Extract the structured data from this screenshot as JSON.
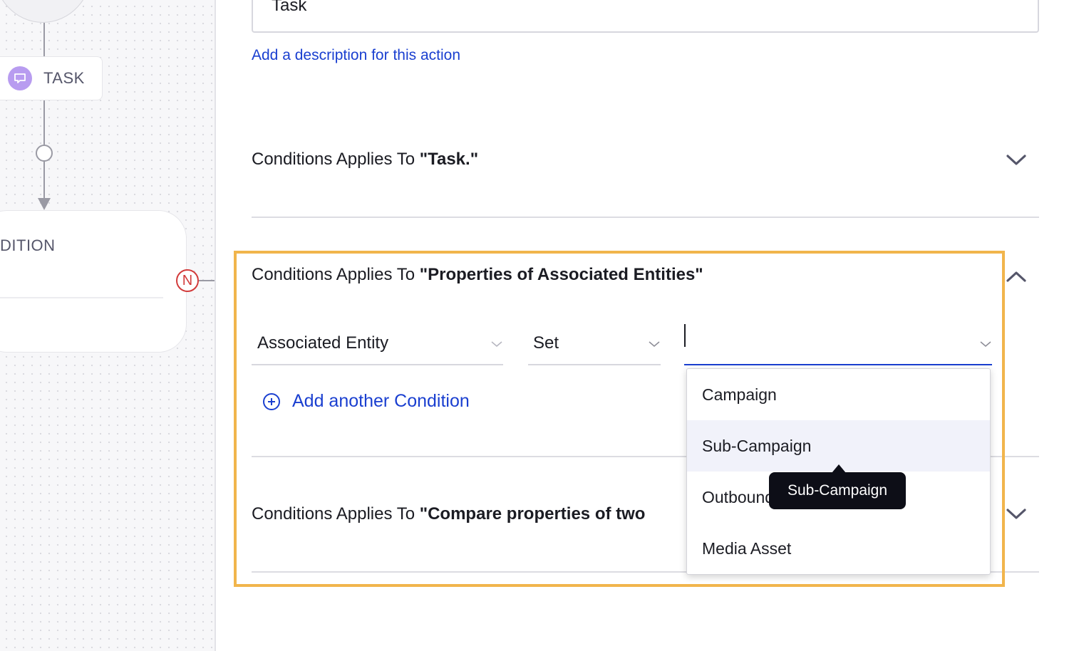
{
  "canvas": {
    "task_node": {
      "label": "TASK",
      "icon": "chat-bubble-icon",
      "icon_color": "#b89cf0"
    },
    "condition_node": {
      "label_partial": "DITION"
    },
    "no_branch_badge": "N"
  },
  "action": {
    "name_value": "Task",
    "add_description_link": "Add a description for this action"
  },
  "sections": [
    {
      "prefix": "Conditions Applies To ",
      "target": "\"Task.\"",
      "expanded": false,
      "toggle_icon": "chevron-down-icon"
    },
    {
      "prefix": "Conditions Applies To ",
      "target": "\"Properties of Associated Entities\"",
      "expanded": true,
      "toggle_icon": "chevron-up-icon",
      "condition_row": {
        "field_select": "Associated Entity",
        "operator_select": "Set",
        "value_select": ""
      },
      "add_condition_label": "Add another Condition"
    },
    {
      "prefix": "Conditions Applies To ",
      "target": "\"Compare properties of two",
      "expanded": false,
      "toggle_icon": "chevron-down-icon"
    }
  ],
  "dropdown": {
    "options": [
      "Campaign",
      "Sub-Campaign",
      "Outbound",
      "Media Asset"
    ],
    "hovered_index": 1,
    "visible_option_3_text": "Outboun"
  },
  "tooltip": {
    "text": "Sub-Campaign"
  },
  "colors": {
    "link_blue": "#1a3fd0",
    "highlight_orange": "#f1b54c",
    "no_badge_red": "#d23b3b",
    "tooltip_bg": "#0d0e17"
  }
}
